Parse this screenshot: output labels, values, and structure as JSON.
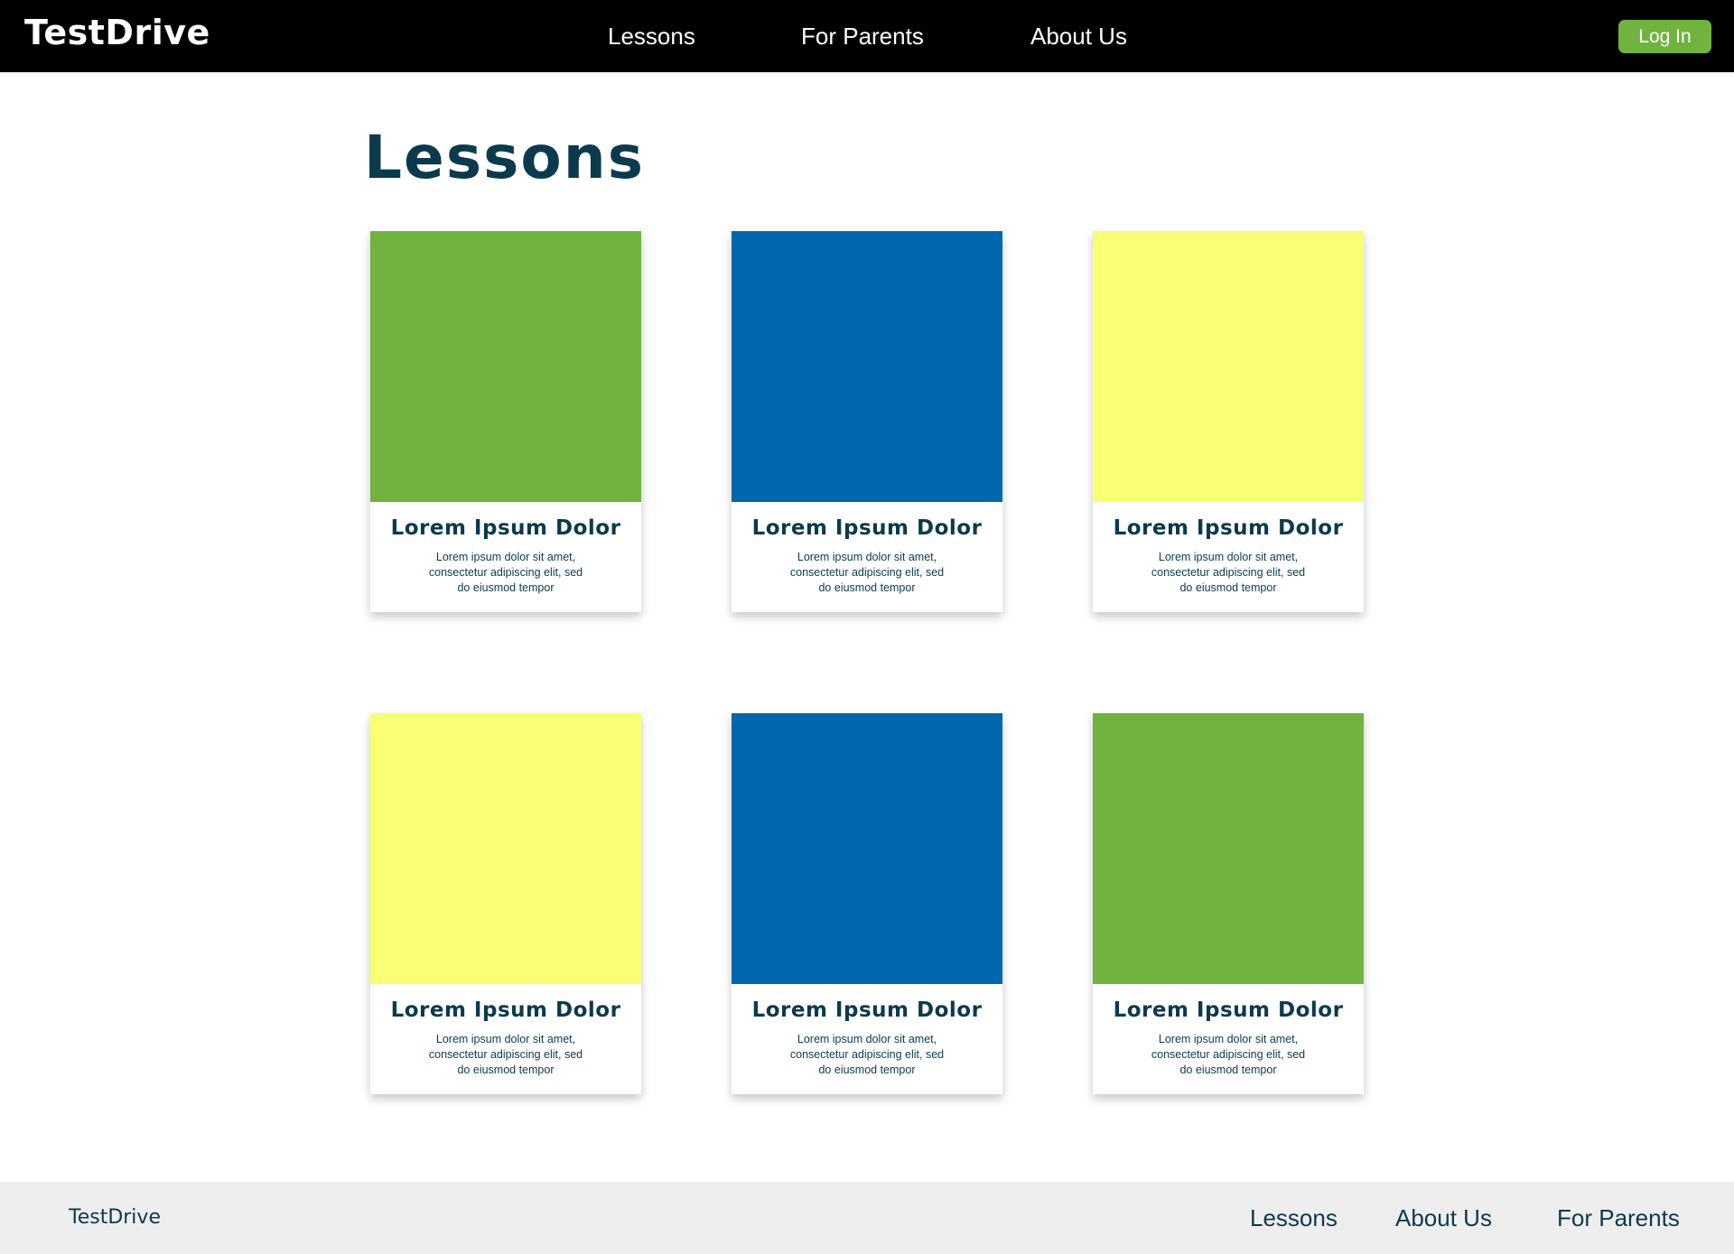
{
  "header": {
    "brand": "TestDrive",
    "nav": [
      {
        "label": "Lessons"
      },
      {
        "label": "For Parents"
      },
      {
        "label": "About Us"
      }
    ],
    "login_label": "Log In"
  },
  "main": {
    "title": "Lessons",
    "cards": [
      {
        "color": "#70b43f",
        "title": "Lorem Ipsum Dolor",
        "line1": "Lorem ipsum dolor sit amet,",
        "line2": "consectetur adipiscing elit, sed",
        "line3": "do eiusmod tempor"
      },
      {
        "color": "#0066ae",
        "title": "Lorem Ipsum Dolor",
        "line1": "Lorem ipsum dolor sit amet,",
        "line2": "consectetur adipiscing elit, sed",
        "line3": "do eiusmod tempor"
      },
      {
        "color": "#f9ff73",
        "title": "Lorem Ipsum Dolor",
        "line1": "Lorem ipsum dolor sit amet,",
        "line2": "consectetur adipiscing elit, sed",
        "line3": "do eiusmod tempor"
      },
      {
        "color": "#f9ff73",
        "title": "Lorem Ipsum Dolor",
        "line1": "Lorem ipsum dolor sit amet,",
        "line2": "consectetur adipiscing elit, sed",
        "line3": "do eiusmod tempor"
      },
      {
        "color": "#0066ae",
        "title": "Lorem Ipsum Dolor",
        "line1": "Lorem ipsum dolor sit amet,",
        "line2": "consectetur adipiscing elit, sed",
        "line3": "do eiusmod tempor"
      },
      {
        "color": "#70b43f",
        "title": "Lorem Ipsum Dolor",
        "line1": "Lorem ipsum dolor sit amet,",
        "line2": "consectetur adipiscing elit, sed",
        "line3": "do eiusmod tempor"
      }
    ]
  },
  "footer": {
    "brand": "TestDrive",
    "links": [
      {
        "label": "Lessons"
      },
      {
        "label": "About Us"
      },
      {
        "label": "For Parents"
      }
    ]
  },
  "colors": {
    "header_bg": "#000000",
    "accent_green": "#70b43f",
    "accent_blue": "#0066ae",
    "accent_yellow": "#f9ff73",
    "text_navy": "#0c3a4d",
    "footer_bg": "#eeeeee"
  }
}
